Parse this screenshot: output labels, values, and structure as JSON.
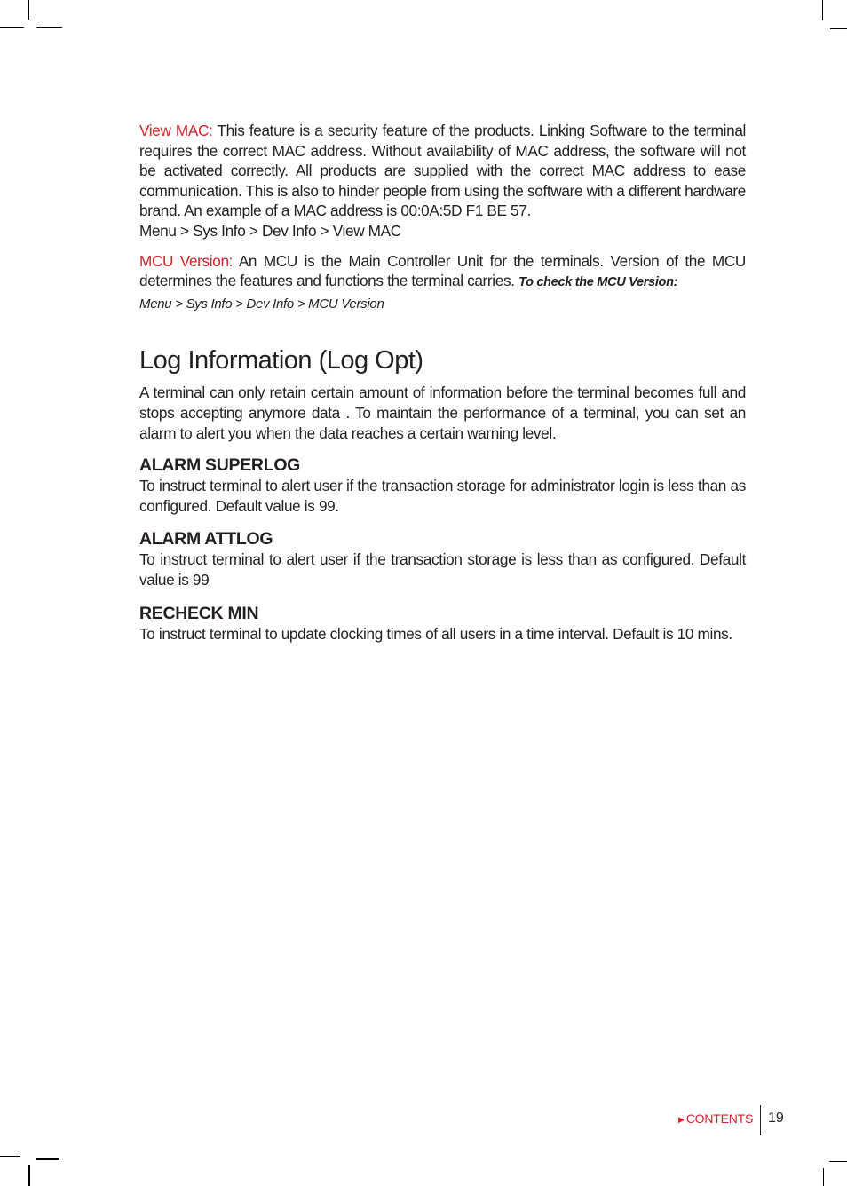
{
  "view_mac": {
    "label": "View MAC:",
    "text": " This feature is a security feature of the products. Linking Software to the terminal requires the correct MAC address. Without availability of MAC address, the software will not be activated correctly. All products are supplied with the correct MAC address to ease  communication. This is also to hinder people from using the software with a different hardware brand.  An example of a MAC address is 00:0A:5D F1 BE 57.",
    "path": "Menu > Sys Info > Dev Info > View MAC"
  },
  "mcu_version": {
    "label": "MCU Version:",
    "text": " An MCU is the Main Controller Unit for the terminals. Version of the MCU determines the features and functions the terminal carries. ",
    "check_label": "To check the MCU Version:",
    "path": "Menu > Sys Info > Dev Info > MCU Version"
  },
  "log_info": {
    "title": "Log Information (Log Opt)",
    "intro": "A terminal can only retain certain amount of information before the terminal becomes full and stops accepting anymore data . To maintain the performance of a terminal, you can set an alarm to alert you when the data reaches a certain warning level.",
    "items": [
      {
        "heading": "ALARM SUPERLOG",
        "text": "To instruct terminal to alert user if the transaction storage for administrator login is less than as configured. Default value is 99."
      },
      {
        "heading": "ALARM ATTLOG",
        "text": "To instruct terminal to alert user if the transaction storage is less than as configured. Default value is 99"
      },
      {
        "heading": "RECHECK MIN",
        "text": "To instruct terminal to update clocking times of all users in a time interval. Default is 10 mins."
      }
    ]
  },
  "footer": {
    "contents_icon": "triangle-right-icon",
    "contents_label": "CONTENTS",
    "page_number": "19"
  },
  "colors": {
    "accent": "#d2232a",
    "text": "#231f20"
  }
}
